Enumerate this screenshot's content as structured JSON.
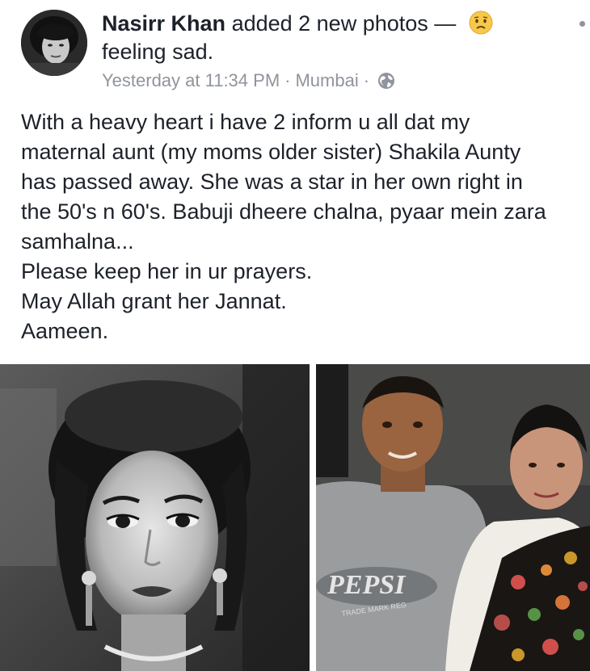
{
  "post": {
    "author": "Nasirr Khan",
    "action_text": " added 2 new photos — ",
    "feeling_text": "feeling sad.",
    "timestamp": "Yesterday at 11:34 PM",
    "separator": "·",
    "location": "Mumbai",
    "privacy_icon": "globe-icon",
    "feeling_icon": "sad-face-emoji",
    "text_lines": [
      "With a heavy heart i have 2 inform u all dat my",
      "maternal aunt (my moms older sister) Shakila Aunty",
      "has passed away. She was a star in her own right in",
      "the 50's n 60's. Babuji dheere chalna, pyaar mein zara",
      "samhalna...",
      "Please keep her in ur prayers.",
      "May Allah grant her Jannat.",
      "Aameen."
    ],
    "photo2_shirt_text": "PEPSI",
    "photo2_shirt_subtext": "TRADE MARK REG"
  },
  "colors": {
    "text": "#1d2129",
    "meta": "#90949c",
    "emoji": "#f7c84a"
  }
}
